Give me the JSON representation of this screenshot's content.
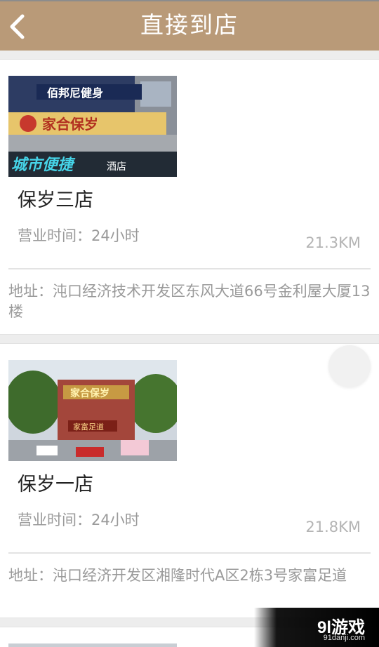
{
  "header": {
    "title": "直接到店"
  },
  "stores": [
    {
      "name": "保岁三店",
      "hours": "营业时间：24小时",
      "distance": "21.3KM",
      "address": "地址：沌口经济技术开发区东风大道66号金利屋大厦13楼",
      "photo_sign_top": "佰邦尼健身",
      "photo_sign_mid": "家合保岁",
      "photo_sign_bottom": "城市便捷",
      "photo_sign_bottom_small": "酒店"
    },
    {
      "name": "保岁一店",
      "hours": "营业时间：24小时",
      "distance": "21.8KM",
      "address": "地址：沌口经济开发区湘隆时代A区2栋3号家富足道",
      "photo_sign_top": "家合保岁",
      "photo_sign_mid": "家富足道"
    }
  ],
  "watermark": {
    "logo": "9l游戏",
    "url": "91danji.com"
  },
  "colors": {
    "header": "#b99a78",
    "background": "#ededed"
  },
  "icons": {
    "back": "chevron-left-icon",
    "fab": "circle-button-icon"
  }
}
